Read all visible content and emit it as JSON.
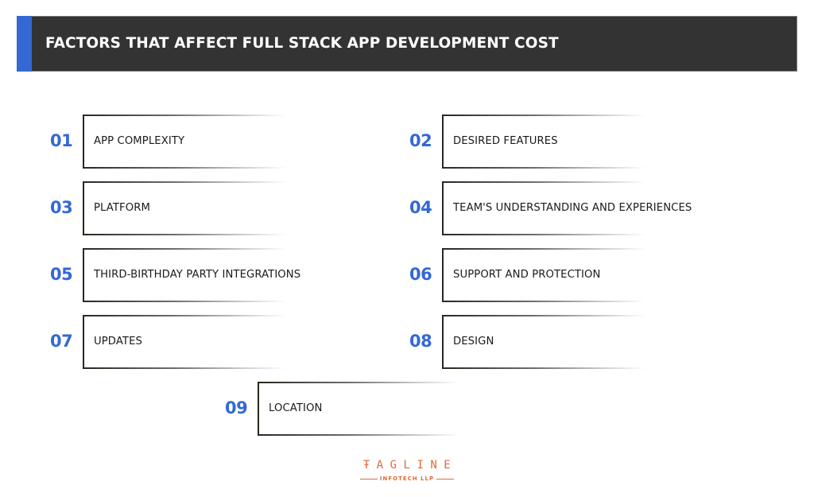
{
  "header": {
    "title": "FACTORS THAT AFFECT FULL STACK APP DEVELOPMENT COST",
    "accent_color": "#3468d4",
    "background_color": "#333333"
  },
  "factors": [
    {
      "number": "01",
      "label": "APP COMPLEXITY"
    },
    {
      "number": "02",
      "label": "DESIRED FEATURES"
    },
    {
      "number": "03",
      "label": "PLATFORM"
    },
    {
      "number": "04",
      "label": "TEAM'S UNDERSTANDING AND EXPERIENCES"
    },
    {
      "number": "05",
      "label": "THIRD-BIRTHDAY PARTY INTEGRATIONS"
    },
    {
      "number": "06",
      "label": "SUPPORT AND PROTECTION"
    },
    {
      "number": "07",
      "label": "UPDATES"
    },
    {
      "number": "08",
      "label": "DESIGN"
    },
    {
      "number": "09",
      "label": "LOCATION"
    }
  ],
  "number_color": "#3468d4",
  "logo": {
    "name": "ŦAGLINE",
    "subtitle": "INFOTECH LLP",
    "color": "#e06a3a"
  }
}
